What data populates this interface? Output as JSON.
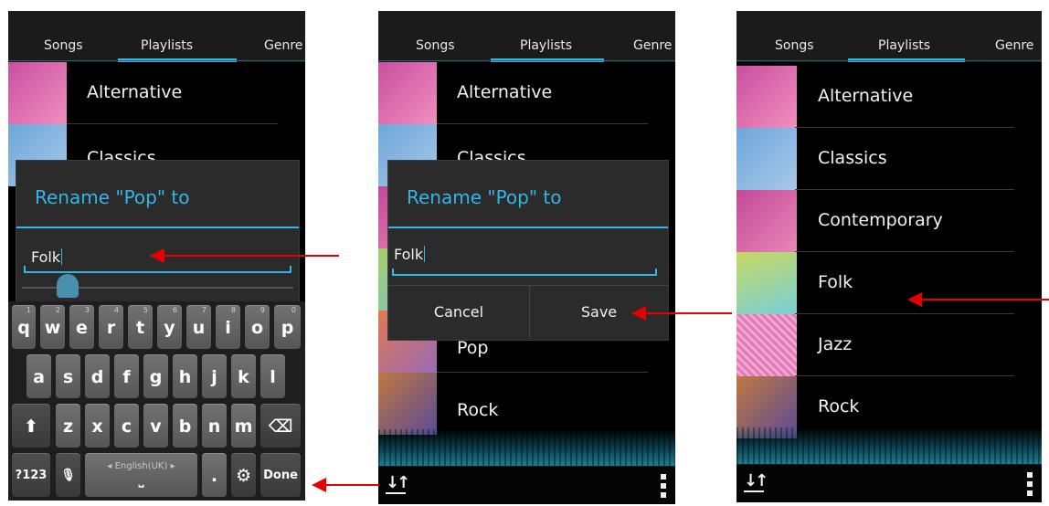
{
  "tabs": [
    "Songs",
    "Playlists",
    "Genre"
  ],
  "screen1": {
    "playlist_rows": [
      "Alternative",
      "Classics"
    ],
    "dialog": {
      "title": "Rename \"Pop\" to",
      "input_value": "Folk"
    },
    "keyboard": {
      "row1": [
        {
          "key": "q",
          "num": "1"
        },
        {
          "key": "w",
          "num": "2"
        },
        {
          "key": "e",
          "num": "3"
        },
        {
          "key": "r",
          "num": "4"
        },
        {
          "key": "t",
          "num": "5"
        },
        {
          "key": "y",
          "num": "6"
        },
        {
          "key": "u",
          "num": "7"
        },
        {
          "key": "i",
          "num": "8"
        },
        {
          "key": "o",
          "num": "9"
        },
        {
          "key": "p",
          "num": "0"
        }
      ],
      "row2": [
        "a",
        "s",
        "d",
        "f",
        "g",
        "h",
        "j",
        "k",
        "l"
      ],
      "row3": [
        "z",
        "x",
        "c",
        "v",
        "b",
        "n",
        "m"
      ],
      "shift_glyph": "⬆",
      "backspace_glyph": "⌫",
      "symbols_label": "?123",
      "mic_glyph": "🎙",
      "language_label": "◂ English(UK) ▸",
      "space_glyph": "⎵",
      "period_label": ".",
      "settings_glyph": "⚙",
      "done_label": "Done"
    }
  },
  "screen2": {
    "playlist_rows": [
      "Alternative",
      "Classics",
      "",
      "",
      "Pop",
      "Rock"
    ],
    "dialog": {
      "title": "Rename \"Pop\" to",
      "input_value": "Folk",
      "cancel_label": "Cancel",
      "save_label": "Save"
    }
  },
  "screen3": {
    "playlist_rows": [
      "Alternative",
      "Classics",
      "Contemporary",
      "Folk",
      "Jazz",
      "Rock"
    ]
  },
  "icons": {
    "sort": "↓↑",
    "overflow_menu": "overflow-menu-icon"
  },
  "colors": {
    "accent": "#33b5e5",
    "annotation_arrow": "#e60000"
  }
}
